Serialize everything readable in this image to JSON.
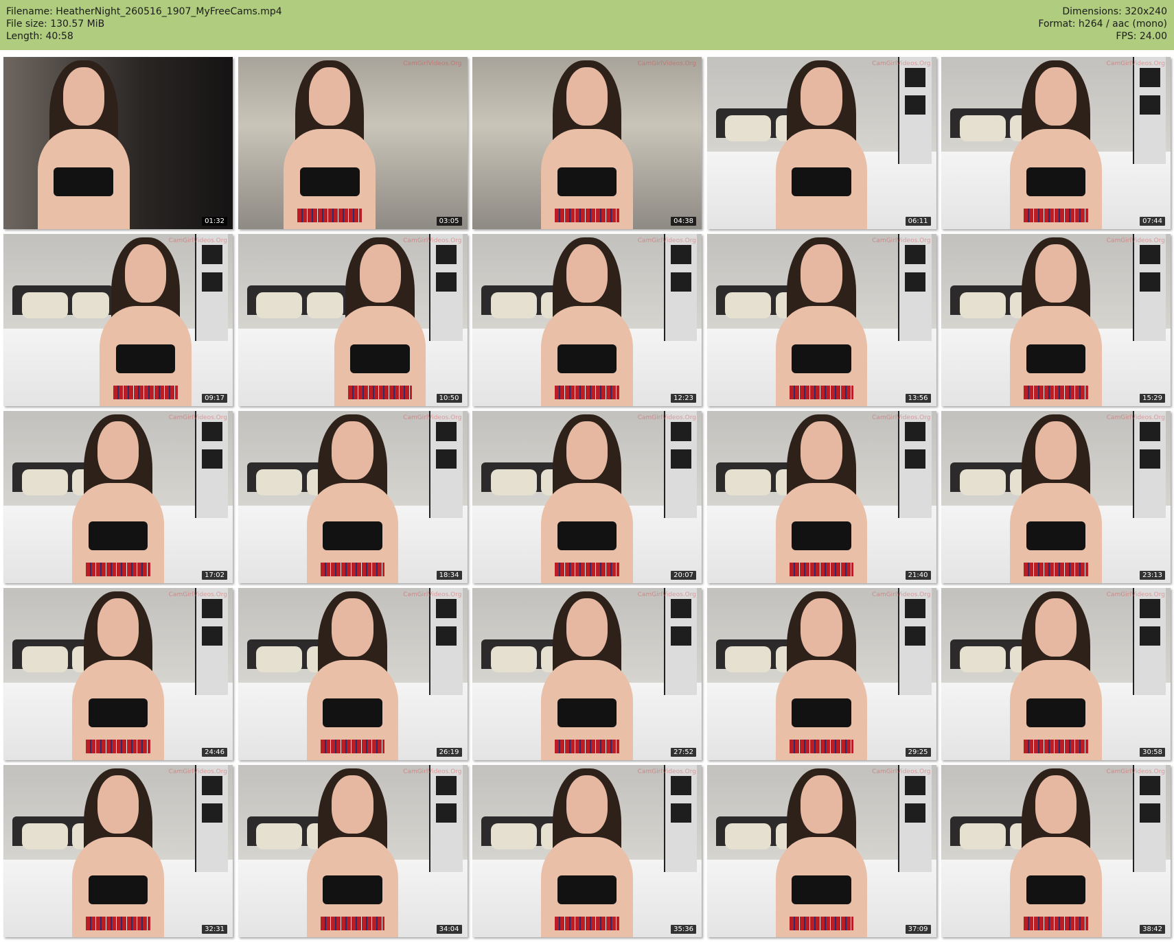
{
  "header": {
    "filename_line": "Filename: HeatherNight_260516_1907_MyFreeCams.mp4",
    "filesize_line": "File size: 130.57 MiB",
    "length_line": "Length: 40:58",
    "dimensions_line": "Dimensions: 320x240",
    "format_line": "Format: h264 / aac (mono)",
    "fps_line": "FPS: 24.00",
    "background_color": "#b0cc7e"
  },
  "watermark": "CamGirlVideos.Org",
  "thumbnails": [
    {
      "timestamp": "01:32",
      "scene": "closeup-dark"
    },
    {
      "timestamp": "03:05",
      "scene": "kitchen"
    },
    {
      "timestamp": "04:38",
      "scene": "kitchen-torso"
    },
    {
      "timestamp": "06:11",
      "scene": "closeup"
    },
    {
      "timestamp": "07:44",
      "scene": "bed-kneel"
    },
    {
      "timestamp": "09:17",
      "scene": "bed-lying"
    },
    {
      "timestamp": "10:50",
      "scene": "bed-lying"
    },
    {
      "timestamp": "12:23",
      "scene": "bed-kneel"
    },
    {
      "timestamp": "13:56",
      "scene": "bed-sit"
    },
    {
      "timestamp": "15:29",
      "scene": "bed-sit"
    },
    {
      "timestamp": "17:02",
      "scene": "bed-sit"
    },
    {
      "timestamp": "18:34",
      "scene": "bed-sit"
    },
    {
      "timestamp": "20:07",
      "scene": "bed-sit"
    },
    {
      "timestamp": "21:40",
      "scene": "bed-sit"
    },
    {
      "timestamp": "23:13",
      "scene": "bed-sit"
    },
    {
      "timestamp": "24:46",
      "scene": "bed-sit"
    },
    {
      "timestamp": "26:19",
      "scene": "bed-sit"
    },
    {
      "timestamp": "27:52",
      "scene": "bed-sit"
    },
    {
      "timestamp": "29:25",
      "scene": "bed-sit"
    },
    {
      "timestamp": "30:58",
      "scene": "bed-sit"
    },
    {
      "timestamp": "32:31",
      "scene": "bed-sit"
    },
    {
      "timestamp": "34:04",
      "scene": "bed-sit"
    },
    {
      "timestamp": "35:36",
      "scene": "bed-sit"
    },
    {
      "timestamp": "37:09",
      "scene": "bed-sit"
    },
    {
      "timestamp": "38:42",
      "scene": "bed-sit"
    }
  ]
}
